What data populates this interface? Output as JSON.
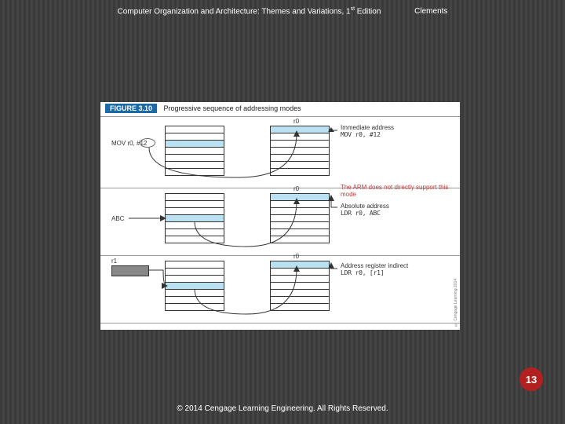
{
  "header": {
    "title_pre": "Computer Organization and Architecture: Themes and Variations, 1",
    "title_sup": "st",
    "title_post": " Edition",
    "author": "Clements"
  },
  "figure": {
    "badge": "FIGURE 3.10",
    "caption": "Progressive sequence of addressing modes",
    "side_copyright": "© Cengage Learning 2014",
    "panels": [
      {
        "left_code": "MOV r0, #12",
        "left_oval_target": "#12",
        "r0_label": "r0",
        "desc_title": "Immediate address",
        "desc_code": "MOV r0, #12"
      },
      {
        "left_label": "ABC",
        "r0_label": "r0",
        "note": "The ARM does not directly support this mode",
        "desc_title": "Absolute address",
        "desc_code": "LDR r0, ABC"
      },
      {
        "left_reg": "r1",
        "r0_label": "r0",
        "desc_title": "Address register indirect",
        "desc_code": "LDR r0, [r1]"
      }
    ]
  },
  "page_number": "13",
  "footer": "© 2014 Cengage Learning Engineering. All Rights Reserved."
}
